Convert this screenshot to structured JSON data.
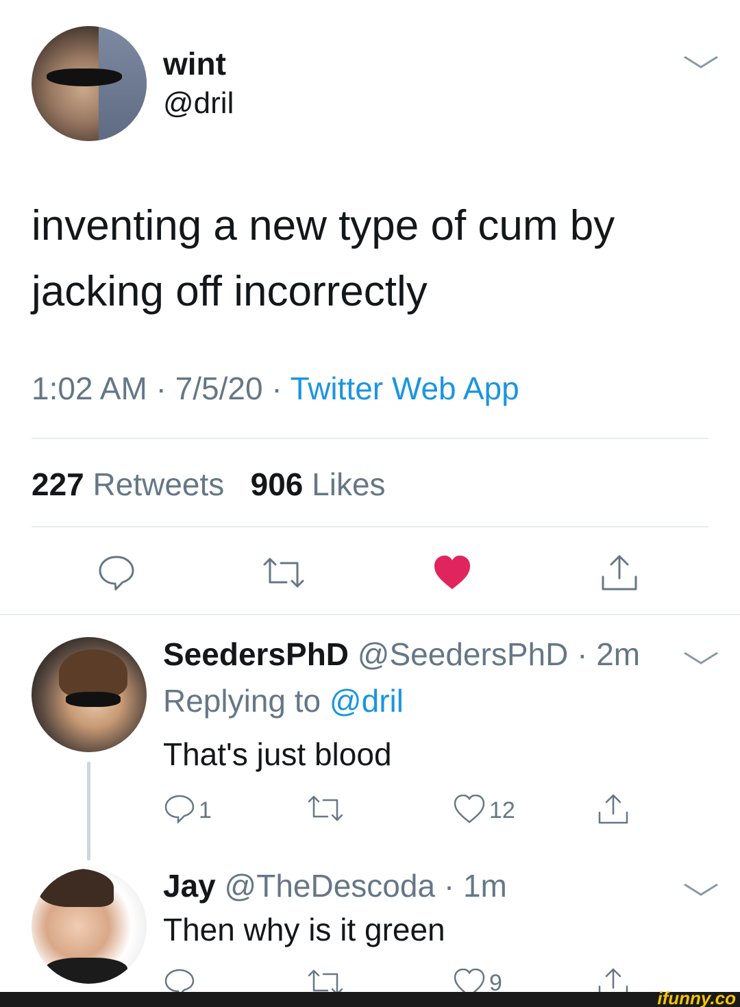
{
  "main_tweet": {
    "display_name": "wint",
    "handle": "@dril",
    "text": "inventing a new type of cum by jacking off incorrectly",
    "time": "1:02 AM",
    "date": "7/5/20",
    "source": "Twitter Web App",
    "retweets_count": "227",
    "retweets_label": "Retweets",
    "likes_count": "906",
    "likes_label": "Likes",
    "liked": true,
    "like_color": "#e0245e"
  },
  "replies": [
    {
      "display_name": "SeedersPhD",
      "handle": "@SeedersPhD",
      "age": "2m",
      "replying_label": "Replying to",
      "replying_to": "@dril",
      "text": "That's just blood",
      "reply_count": "1",
      "like_count": "12"
    },
    {
      "display_name": "Jay",
      "handle": "@TheDescoda",
      "age": "1m",
      "text": "Then why is it green",
      "reply_count": "",
      "like_count": "9"
    }
  ],
  "separator": "·",
  "watermark": "ifunny.co",
  "colors": {
    "link": "#1b95e0",
    "secondary_text": "#657786",
    "divider": "#e6ecf0"
  }
}
